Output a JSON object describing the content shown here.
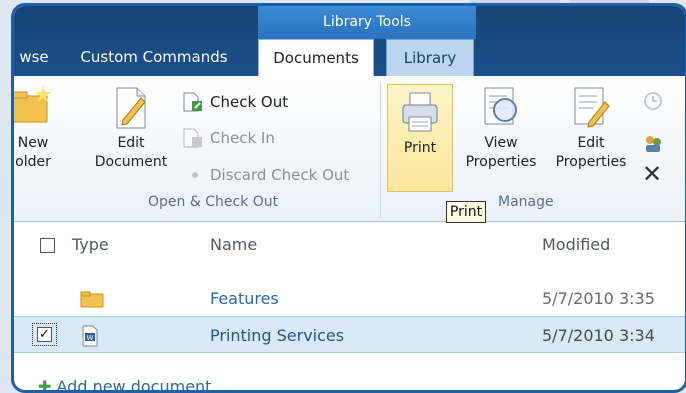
{
  "ribbon": {
    "context_header": "Library Tools",
    "tabs": {
      "browse": "wse",
      "custom_commands": "Custom Commands",
      "documents": "Documents",
      "library": "Library"
    },
    "new_folder": {
      "line1": "New",
      "line2": "older"
    },
    "edit_document": {
      "line1": "Edit",
      "line2": "Document"
    },
    "check_out": "Check Out",
    "check_in": "Check In",
    "discard_check_out": "Discard Check Out",
    "group_open_checkout": "Open & Check Out",
    "print": "Print",
    "view_properties": {
      "line1": "View",
      "line2": "Properties"
    },
    "edit_properties": {
      "line1": "Edit",
      "line2": "Properties"
    },
    "group_manage": "Manage",
    "tooltip": "Print"
  },
  "list": {
    "columns": {
      "type": "Type",
      "name": "Name",
      "modified": "Modified"
    },
    "rows": [
      {
        "name": "Features",
        "modified": "5/7/2010 3:35",
        "icon": "folder-icon",
        "selected": false
      },
      {
        "name": "Printing Services",
        "modified": "5/7/2010 3:34",
        "icon": "word-doc-icon",
        "selected": true
      }
    ],
    "add_new": "Add new document"
  },
  "colors": {
    "ribbon_dark": "#17457a",
    "context_tab": "#2a72be",
    "link": "#2a6aa8",
    "selected_row": "#d8eaf8",
    "print_highlight": "#fbe69a"
  }
}
